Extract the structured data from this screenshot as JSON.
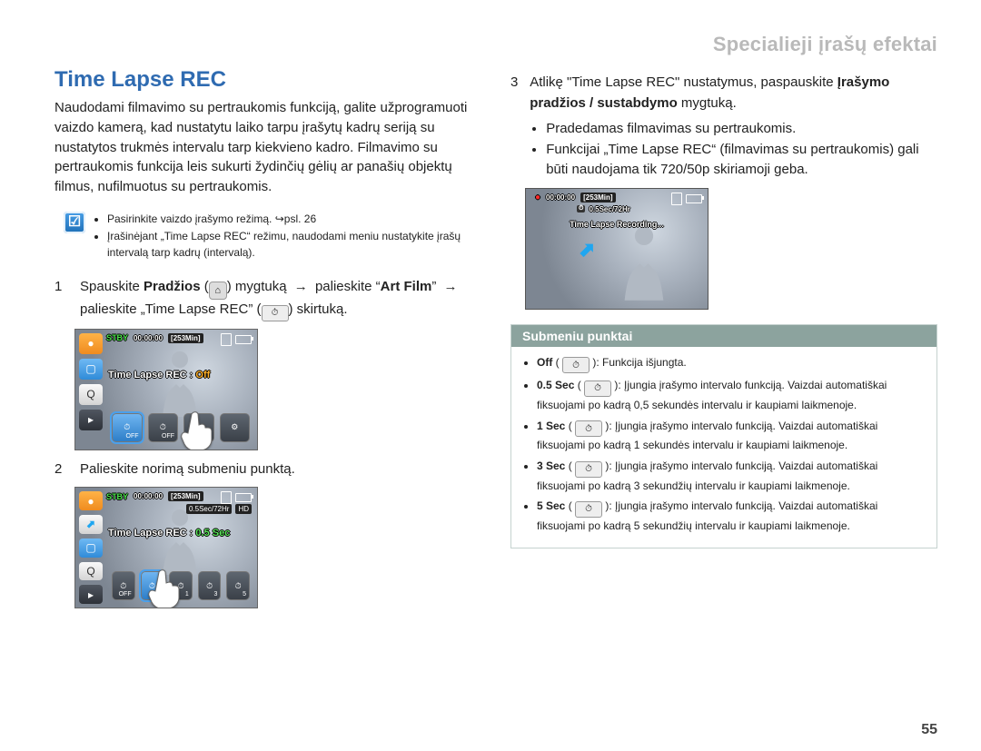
{
  "breadcrumb": "Specialieji įrašų efektai",
  "title": "Time Lapse REC",
  "intro": "Naudodami filmavimo su pertraukomis funkciją, galite užprogramuoti vaizdo kamerą, kad nustatytu laiko tarpu įrašytų kadrų seriją su nustatytos trukmės intervalu tarp kiekvieno kadro. Filmavimo su pertraukomis funkcija leis sukurti žydinčių gėlių ar panašių objektų filmus, nufilmuotus su pertraukomis.",
  "tips": [
    "Pasirinkite vaizdo įrašymo režimą. ↪psl. 26",
    "Įrašinėjant „Time Lapse REC“ režimu, naudodami meniu nustatykite įrašų intervalą tarp kadrų (intervalą)."
  ],
  "steps": {
    "s1_num": "1",
    "s1_a": "Spauskite ",
    "s1_b": "Pradžios",
    "s1_c": " mygtuką ",
    "s1_d": " palieskite “",
    "s1_e": "Art Film",
    "s1_f": "” ",
    "s1_g": "palieskite „Time Lapse REC” (",
    "s1_h": ") skirtuką.",
    "s2_num": "2",
    "s2": "Palieskite norimą submeniu punktą.",
    "s3_num": "3",
    "s3_a": "Atlikę \"Time Lapse REC\" nustatymus, paspauskite ",
    "s3_b": "Įrašymo pradžios / sustabdymo",
    "s3_c": " mygtuką.",
    "s3_bul1": "Pradedamas filmavimas su pertraukomis.",
    "s3_bul2": "Funkcijai „Time Lapse REC“ (filmavimas su pertraukomis) gali būti naudojama tik 720/50p skiriamoji geba."
  },
  "lcd1": {
    "stby": "STBY",
    "time": "00:00:00",
    "remain": "[253Min]",
    "label": "Time Lapse REC : ",
    "value": "Off",
    "modes": [
      "OFF",
      "OFF",
      "OFF",
      "⚙"
    ]
  },
  "lcd2": {
    "stby": "STBY",
    "time": "00:00:00",
    "remain": "[253Min]",
    "sub": "0.5Sec/72Hr",
    "label": "Time Lapse REC : ",
    "value": "0.5 Sec",
    "modes": [
      "OFF",
      "0.5",
      "1",
      "3",
      "5"
    ]
  },
  "lcd3": {
    "rec": "●",
    "time": "00:00:00",
    "remain": "[253Min]",
    "sub": "0.5Sec/72Hr",
    "rec_label": "Time Lapse Recording..."
  },
  "submenu": {
    "header": "Submeniu punktai",
    "items": [
      {
        "name": "Off",
        "desc": ": Funkcija išjungta."
      },
      {
        "name": "0.5 Sec",
        "desc": ": Įjungia įrašymo intervalo funkciją. Vaizdai automatiškai fiksuojami po kadrą 0,5 sekundės intervalu ir kaupiami laikmenoje."
      },
      {
        "name": "1 Sec",
        "desc": ": Įjungia įrašymo intervalo funkciją. Vaizdai automatiškai fiksuojami po kadrą 1 sekundės intervalu ir kaupiami laikmenoje."
      },
      {
        "name": "3 Sec",
        "desc": ": Įjungia įrašymo intervalo funkciją. Vaizdai automatiškai fiksuojami po kadrą 3 sekundžių intervalu ir kaupiami laikmenoje."
      },
      {
        "name": "5 Sec",
        "desc": ": Įjungia įrašymo intervalo funkciją. Vaizdai automatiškai fiksuojami po kadrą 5 sekundžių intervalu ir kaupiami laikmenoje."
      }
    ]
  },
  "page_number": "55"
}
